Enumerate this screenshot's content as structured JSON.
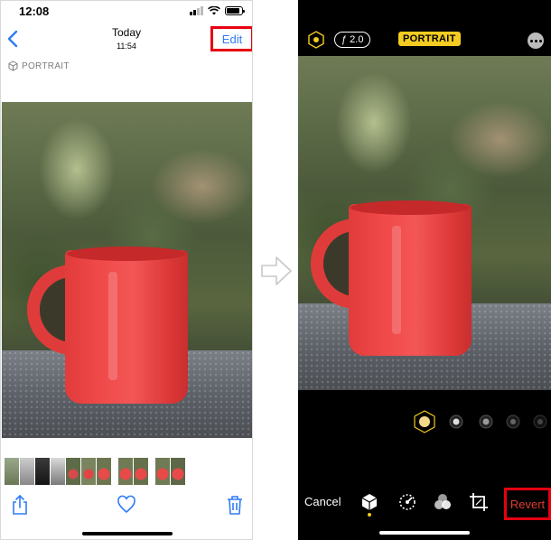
{
  "left_phone": {
    "status_time": "12:08",
    "nav_title": "Today",
    "nav_subtitle": "11:54",
    "edit_label": "Edit",
    "portrait_label": "PORTRAIT",
    "accent_color": "#2f7bf5",
    "highlight_color": "#e60012"
  },
  "right_phone": {
    "fstop_label": "ƒ 2.0",
    "portrait_badge": "PORTRAIT",
    "cancel_label": "Cancel",
    "revert_label": "Revert",
    "badge_color": "#f5cc21",
    "revert_color": "#e23a30"
  },
  "icons": {
    "left_toolbar": [
      "share-icon",
      "heart-icon",
      "trash-icon"
    ],
    "right_toolbar": [
      "portrait-cube-icon",
      "adjust-icon",
      "filters-icon",
      "crop-icon"
    ],
    "lighting": [
      "natural-light-icon",
      "studio-light-icon",
      "contour-light-icon",
      "stage-light-icon",
      "stage-mono-icon"
    ]
  }
}
